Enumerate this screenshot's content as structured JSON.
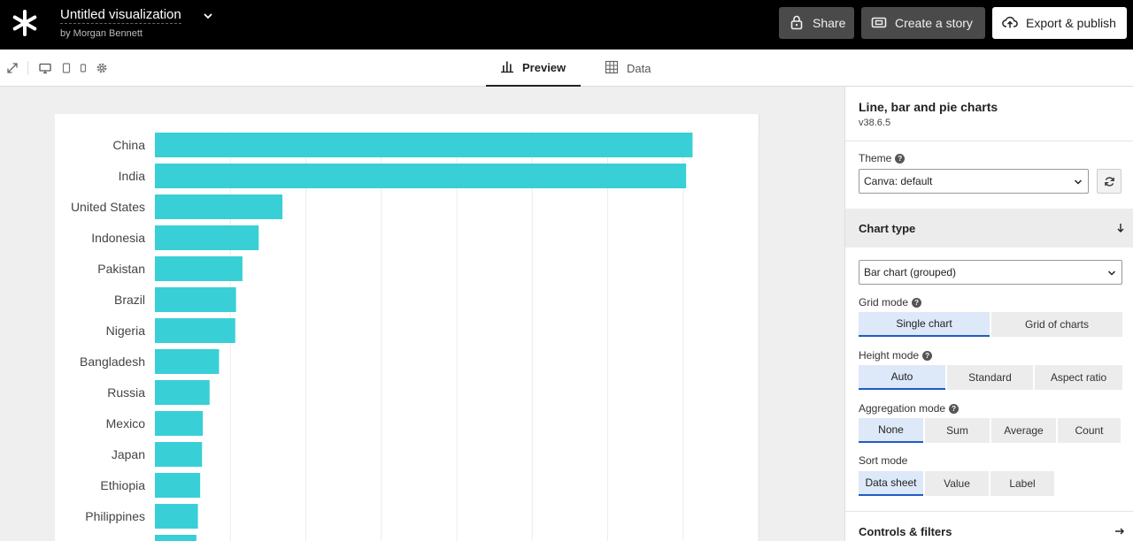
{
  "header": {
    "title": "Untitled visualization",
    "byline": "by Morgan Bennett",
    "share_label": "Share",
    "story_label": "Create a story",
    "export_label": "Export & publish"
  },
  "toolbar": {
    "icons": [
      "expand-icon",
      "desktop-icon",
      "tablet-icon",
      "mobile-icon",
      "settings-icon"
    ],
    "tabs": [
      {
        "label": "Preview",
        "active": true
      },
      {
        "label": "Data",
        "active": false
      }
    ]
  },
  "panel": {
    "name": "Line, bar and pie charts",
    "version": "v38.6.5",
    "theme_label": "Theme",
    "theme_value": "Canva: default",
    "chart_type_heading": "Chart type",
    "chart_type_value": "Bar chart (grouped)",
    "grid_mode": {
      "label": "Grid mode",
      "options": [
        "Single chart",
        "Grid of charts"
      ],
      "selected": 0
    },
    "height_mode": {
      "label": "Height mode",
      "options": [
        "Auto",
        "Standard",
        "Aspect ratio"
      ],
      "selected": 0
    },
    "aggregation_mode": {
      "label": "Aggregation mode",
      "options": [
        "None",
        "Sum",
        "Average",
        "Count"
      ],
      "selected": 0
    },
    "sort_mode": {
      "label": "Sort mode",
      "options": [
        "Data sheet",
        "Value",
        "Label"
      ],
      "selected": 0
    },
    "controls_heading": "Controls & filters"
  },
  "colors": {
    "bar": "#39cfd6",
    "accent": "#1f5cc4",
    "topbar": "#000000"
  },
  "chart_data": {
    "type": "bar",
    "orientation": "horizontal",
    "categories": [
      "China",
      "India",
      "United States",
      "Indonesia",
      "Pakistan",
      "Brazil",
      "Nigeria",
      "Bangladesh",
      "Russia",
      "Mexico",
      "Japan",
      "Ethiopia",
      "Philippines"
    ],
    "values": [
      1425,
      1408,
      338,
      275,
      232,
      215,
      213,
      170,
      145,
      127,
      125,
      120,
      114
    ],
    "xlim": [
      0,
      1600
    ],
    "grid": true
  }
}
